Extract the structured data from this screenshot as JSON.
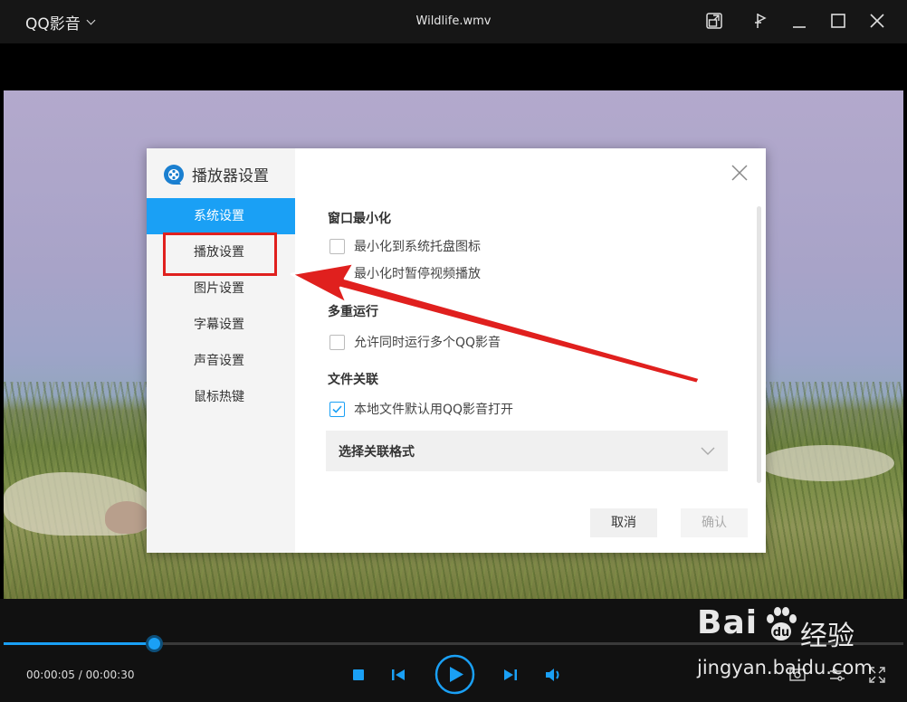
{
  "titlebar": {
    "app_name": "QQ影音",
    "file_title": "Wildlife.wmv"
  },
  "dialog": {
    "title": "播放器设置",
    "nav": [
      {
        "label": "系统设置",
        "active": true
      },
      {
        "label": "播放设置",
        "active": false
      },
      {
        "label": "图片设置",
        "active": false
      },
      {
        "label": "字幕设置",
        "active": false
      },
      {
        "label": "声音设置",
        "active": false
      },
      {
        "label": "鼠标热键",
        "active": false
      }
    ],
    "sections": {
      "minimize": {
        "title": "窗口最小化",
        "options": [
          {
            "label": "最小化到系统托盘图标",
            "checked": false
          },
          {
            "label": "最小化时暂停视频播放",
            "checked": false
          }
        ]
      },
      "multi": {
        "title": "多重运行",
        "options": [
          {
            "label": "允许同时运行多个QQ影音",
            "checked": false
          }
        ]
      },
      "assoc": {
        "title": "文件关联",
        "options": [
          {
            "label": "本地文件默认用QQ影音打开",
            "checked": true
          }
        ],
        "dropdown_label": "选择关联格式"
      }
    },
    "buttons": {
      "cancel": "取消",
      "confirm": "确认"
    }
  },
  "player": {
    "time_display": "00:00:05 / 00:00:30",
    "progress_fraction": 0.167,
    "accent_color": "#1aa0f5"
  },
  "watermark": {
    "logo_text": "Bai",
    "logo_suffix": "经验",
    "url": "jingyan.baidu.com"
  },
  "annotation": {
    "highlight_color": "#e0201e"
  }
}
